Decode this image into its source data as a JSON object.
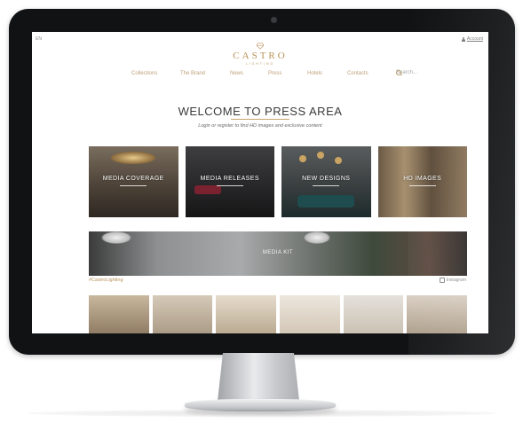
{
  "header": {
    "top_left": "EN",
    "account_label": "Account",
    "logo_main": "CASTRO",
    "logo_sub": "LIGHTING"
  },
  "nav": {
    "items": [
      "Collections",
      "The Brand",
      "News",
      "Press",
      "Hotels",
      "Contacts"
    ],
    "search_placeholder": "Search..."
  },
  "hero": {
    "title": "WELCOME TO PRESS AREA",
    "subtitle": "Login or register to find HD images and exclusive content"
  },
  "tiles": [
    {
      "label": "MEDIA COVERAGE"
    },
    {
      "label": "MEDIA RELEASES"
    },
    {
      "label": "NEW DESIGNS"
    },
    {
      "label": "HD IMAGES"
    }
  ],
  "banner": {
    "label": "MEDIA KIT"
  },
  "instagram": {
    "hashtag": "#CastroLighting",
    "link_label": "Instagram",
    "post_count": 6
  },
  "colors": {
    "brand_gold": "#b9925a",
    "frame": "#111214"
  }
}
